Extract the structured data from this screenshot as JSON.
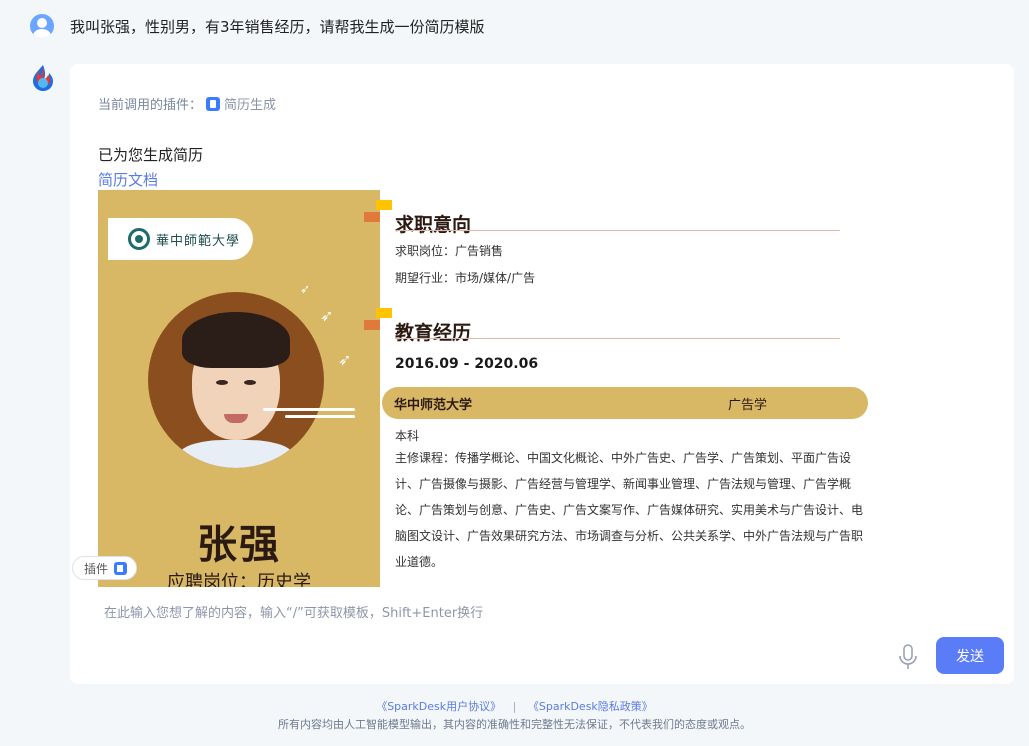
{
  "user": {
    "message": "我叫张强，性别男，有3年销售经历，请帮我生成一份简历模版"
  },
  "reply": {
    "plugin_prefix": "当前调用的插件：",
    "plugin_name": "简历生成",
    "generated_text": "已为您生成简历",
    "doc_link": "简历文档"
  },
  "resume": {
    "school_logo_text": "華中師範大學",
    "name": "张强",
    "apply_position": "应聘岗位：历史学",
    "sections": {
      "intent_title": "求职意向",
      "position": "求职岗位：广告销售",
      "industry": "期望行业：市场/媒体/广告",
      "edu_title": "教育经历",
      "edu_date": "2016.09 - 2020.06",
      "school": "华中师范大学",
      "major": "广告学",
      "degree": "本科",
      "courses": "主修课程：传播学概论、中国文化概论、中外广告史、广告学、广告策划、平面广告设计、广告摄像与摄影、广告经营与管理学、新闻事业管理、广告法规与管理、广告学概论、广告策划与创意、广告史、广告文案写作、广告媒体研究、实用美术与广告设计、电脑图文设计、广告效果研究方法、市场调查与分析、公共关系学、中外广告法规与广告职业道德。"
    }
  },
  "composer": {
    "plugin_tag": "插件",
    "placeholder": "在此输入您想了解的内容，输入“/”可获取模板，Shift+Enter换行",
    "send_label": "发送"
  },
  "footer": {
    "user_agreement": "《SparkDesk用户协议》",
    "separator": "|",
    "privacy_policy": "《SparkDesk隐私政策》",
    "disclaimer": "所有内容均由人工智能模型输出，其内容的准确性和完整性无法保证，不代表我们的态度或观点。"
  },
  "colors": {
    "accent": "#5b7cf7",
    "resume_gold": "#d8b864",
    "marker_yellow": "#ffc300",
    "marker_orange": "#e07a3a"
  }
}
